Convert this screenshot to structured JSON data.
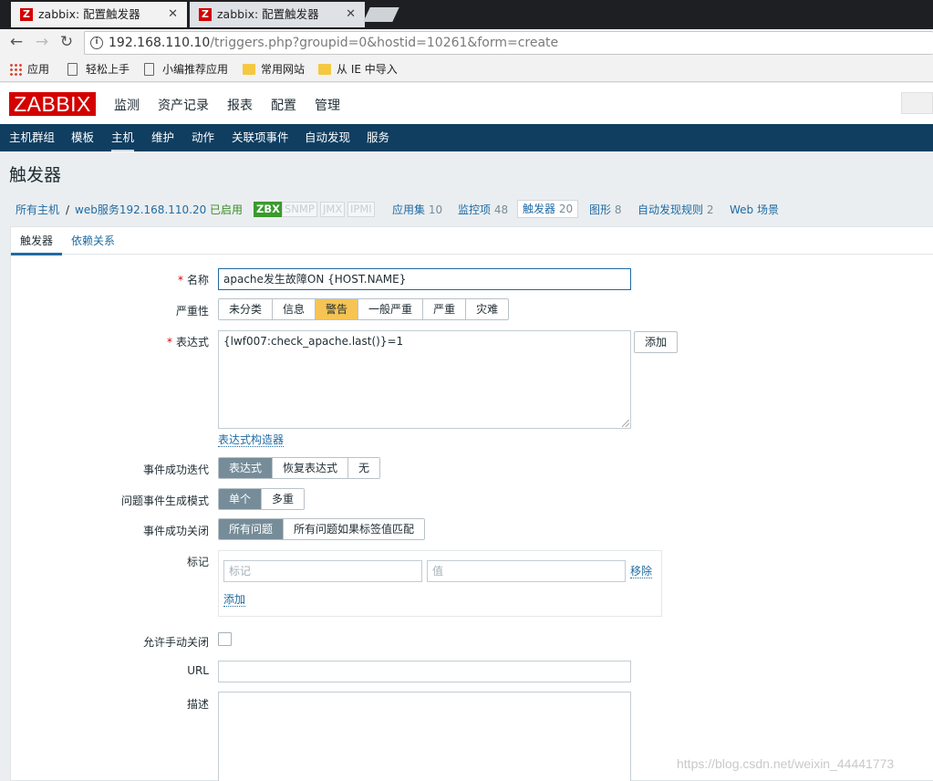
{
  "browser": {
    "tabs": [
      {
        "title": "zabbix: 配置触发器",
        "active": true
      },
      {
        "title": "zabbix: 配置触发器",
        "active": false
      }
    ],
    "url_host": "192.168.110.10",
    "url_path": "/triggers.php?groupid=0&hostid=10261&form=create",
    "bookmarks": [
      "应用",
      "轻松上手",
      "小编推荐应用",
      "常用网站",
      "从 IE 中导入"
    ]
  },
  "header": {
    "logo": "ZABBIX",
    "menu": [
      "监测",
      "资产记录",
      "报表",
      "配置",
      "管理"
    ],
    "submenu": [
      "主机群组",
      "模板",
      "主机",
      "维护",
      "动作",
      "关联项事件",
      "自动发现",
      "服务"
    ]
  },
  "page": {
    "title": "触发器"
  },
  "breadcrumbs": {
    "all_hosts": "所有主机",
    "sep": "/",
    "host": "web服务192.168.110.20",
    "status": "已启用",
    "badges": [
      "ZBX",
      "SNMP",
      "JMX",
      "IPMI"
    ],
    "apps": {
      "label": "应用集",
      "count": "10"
    },
    "items": {
      "label": "监控项",
      "count": "48"
    },
    "triggers": {
      "label": "触发器",
      "count": "20"
    },
    "graphs": {
      "label": "图形",
      "count": "8"
    },
    "discovery": {
      "label": "自动发现规则",
      "count": "2"
    },
    "web": "Web 场景"
  },
  "form": {
    "tabs": [
      "触发器",
      "依赖关系"
    ],
    "required_mark": "*",
    "name_label": "名称",
    "name_value": "apache发生故障ON {HOST.NAME}",
    "severity_label": "严重性",
    "severity_options": [
      "未分类",
      "信息",
      "警告",
      "一般严重",
      "严重",
      "灾难"
    ],
    "severity_selected": "警告",
    "expression_label": "表达式",
    "expression_value": "{lwf007:check_apache.last()}=1",
    "add_button": "添加",
    "expression_builder": "表达式构造器",
    "ok_event_label": "事件成功迭代",
    "ok_event_options": [
      "表达式",
      "恢复表达式",
      "无"
    ],
    "problem_mode_label": "问题事件生成模式",
    "problem_mode_options": [
      "单个",
      "多重"
    ],
    "ok_close_label": "事件成功关闭",
    "ok_close_options": [
      "所有问题",
      "所有问题如果标签值匹配"
    ],
    "tags_label": "标记",
    "tag_placeholder": "标记",
    "value_placeholder": "值",
    "remove_link": "移除",
    "add_link": "添加",
    "manual_close_label": "允许手动关闭",
    "url_label": "URL",
    "description_label": "描述"
  },
  "watermark": "https://blog.csdn.net/weixin_44441773"
}
